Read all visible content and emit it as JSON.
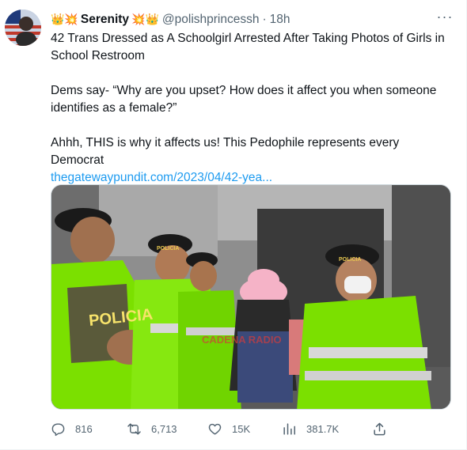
{
  "author": {
    "display_name": "Serenity",
    "emoji_left": "👑💥",
    "emoji_right": "💥👑",
    "handle": "@polishprincessh",
    "separator": "·",
    "time": "18h"
  },
  "more_label": "···",
  "body": {
    "line1": "42 Trans Dressed as A Schoolgirl Arrested After Taking Photos of Girls in School Restroom",
    "line2": "Dems say- “Why are you upset? How does it affect you when someone identifies as a female?”",
    "line3": "Ahhh, THIS is why it affects us! This Pedophile represents every Democrat",
    "link": "thegatewaypundit.com/2023/04/42-yea..."
  },
  "media": {
    "vest_text": "POLICIA",
    "cap_text_1": "POLICIA",
    "cap_text_2": "POLICIA",
    "watermark": "CADENA RADIO"
  },
  "actions": {
    "replies": "816",
    "retweets": "6,713",
    "likes": "15K",
    "views": "381.7K"
  },
  "colors": {
    "link": "#1d9bf0",
    "muted": "#536471",
    "police_green": "#7be000"
  }
}
